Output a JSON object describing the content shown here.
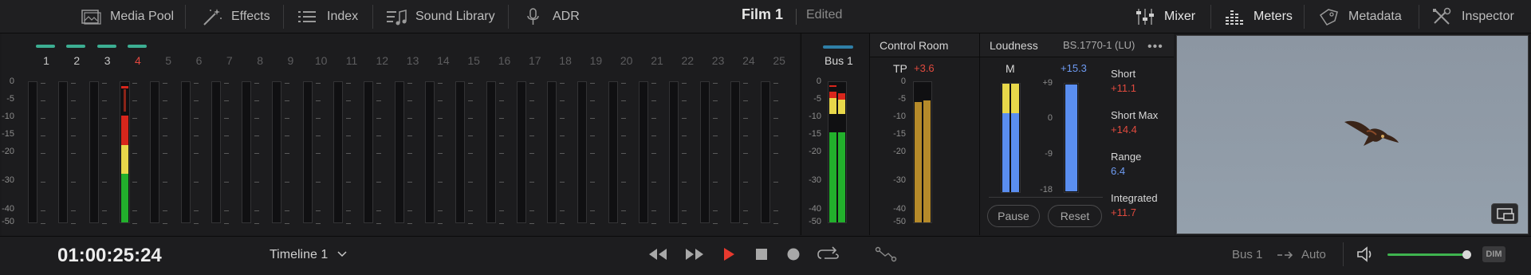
{
  "topbar": {
    "media_pool": "Media Pool",
    "effects": "Effects",
    "index": "Index",
    "sound_library": "Sound Library",
    "adr": "ADR",
    "project_title": "Film 1",
    "project_status": "Edited",
    "mixer": "Mixer",
    "meters": "Meters",
    "metadata": "Metadata",
    "inspector": "Inspector"
  },
  "mixer": {
    "channels": [
      "1",
      "2",
      "3",
      "4",
      "5",
      "6",
      "7",
      "8",
      "9",
      "10",
      "11",
      "12",
      "13",
      "14",
      "15",
      "16",
      "17",
      "18",
      "19",
      "20",
      "21",
      "22",
      "23",
      "24",
      "25"
    ],
    "selected_channel": "4",
    "scale": [
      "0",
      "-5",
      "-10",
      "-15",
      "-20",
      "-30",
      "-40",
      "-50"
    ]
  },
  "bus": {
    "label": "Bus 1",
    "scale": [
      "0",
      "-5",
      "-10",
      "-15",
      "-20",
      "-30",
      "-40",
      "-50"
    ]
  },
  "control_room": {
    "title": "Control Room",
    "tp_label": "TP",
    "tp_value": "+3.6",
    "scale": [
      "0",
      "-5",
      "-10",
      "-15",
      "-20",
      "-30",
      "-40",
      "-50"
    ]
  },
  "loudness": {
    "title": "Loudness",
    "standard": "BS.1770-1 (LU)",
    "m_label": "M",
    "m_value": "+15.3",
    "scale": [
      "+9",
      "0",
      "-9",
      "-18"
    ],
    "short_label": "Short",
    "short_value": "+11.1",
    "short_max_label": "Short Max",
    "short_max_value": "+14.4",
    "range_label": "Range",
    "range_value": "6.4",
    "integrated_label": "Integrated",
    "integrated_value": "+11.7",
    "pause": "Pause",
    "reset": "Reset"
  },
  "transport": {
    "timecode": "01:00:25:24",
    "timeline": "Timeline 1",
    "bus_output": "Bus 1",
    "automation": "Auto",
    "dim": "DIM",
    "volume_level": 0.93
  },
  "colors": {
    "green": "#22b02c",
    "yellow": "#e8d84a",
    "red": "#d8261c",
    "gold": "#b58a2a",
    "blue_meter": "#5a8ef0",
    "red_text": "#e04a3e",
    "blue_text": "#6e9bf2"
  }
}
